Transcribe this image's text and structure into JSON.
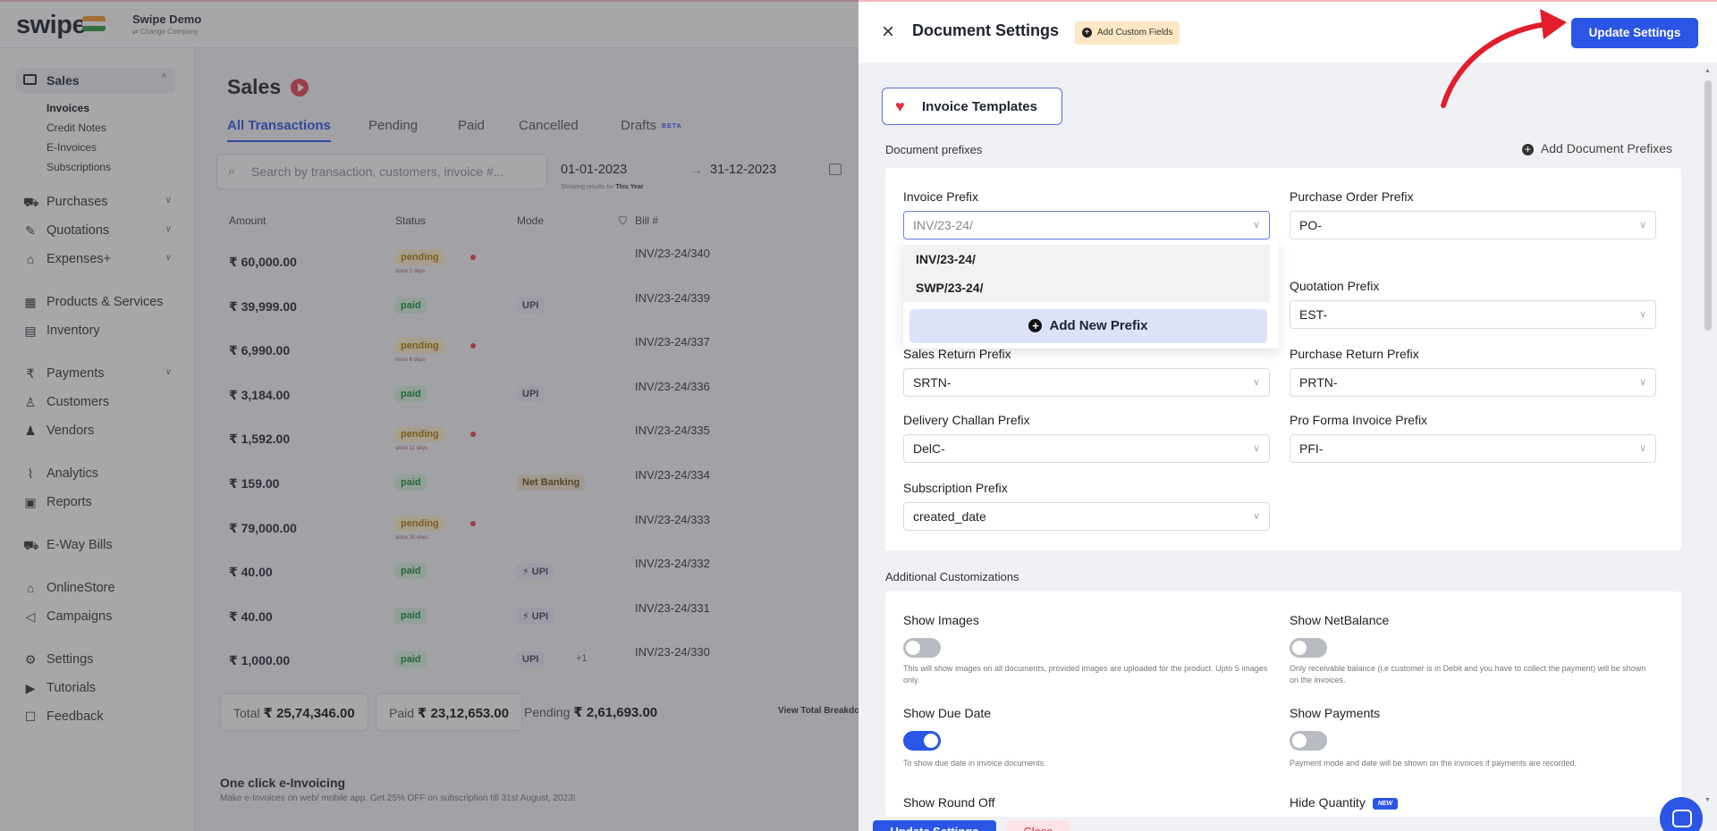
{
  "app": {
    "logo": "swipe",
    "company_name": "Swipe Demo",
    "company_sub": "⇄ Change Company"
  },
  "sidebar": {
    "sales_label": "Sales",
    "sales_sub": [
      "Invoices",
      "Credit Notes",
      "E-Invoices",
      "Subscriptions"
    ],
    "items": [
      {
        "label": "Purchases",
        "icon": "cart-icon"
      },
      {
        "label": "Quotations",
        "icon": "pen-icon"
      },
      {
        "label": "Expenses+",
        "icon": "tag-icon"
      },
      {
        "label": "Products & Services",
        "icon": "barcode-icon"
      },
      {
        "label": "Inventory",
        "icon": "warehouse-icon"
      },
      {
        "label": "Payments",
        "icon": "rupee-icon"
      },
      {
        "label": "Customers",
        "icon": "user-icon"
      },
      {
        "label": "Vendors",
        "icon": "users-icon"
      },
      {
        "label": "Analytics",
        "icon": "chart-icon"
      },
      {
        "label": "Reports",
        "icon": "report-icon"
      },
      {
        "label": "E-Way Bills",
        "icon": "truck-icon"
      },
      {
        "label": "OnlineStore",
        "icon": "store-icon"
      },
      {
        "label": "Campaigns",
        "icon": "megaphone-icon"
      },
      {
        "label": "Settings",
        "icon": "gear-icon"
      },
      {
        "label": "Tutorials",
        "icon": "youtube-icon"
      },
      {
        "label": "Feedback",
        "icon": "chat-icon"
      }
    ]
  },
  "main": {
    "title": "Sales",
    "tabs": [
      "All Transactions",
      "Pending",
      "Paid",
      "Cancelled",
      "Drafts"
    ],
    "beta": "BETA",
    "search_placeholder": "Search by transaction, customers, invoice #...",
    "date_from": "01-01-2023",
    "date_to": "31-12-2023",
    "date_arrow": "→",
    "showing_prefix": "Showing results for",
    "showing_value": "This Year",
    "columns": [
      "Amount",
      "Status",
      "Mode",
      "Bill #"
    ],
    "rows": [
      {
        "amount": "₹ 60,000.00",
        "status": "pending",
        "since": "since 2 days",
        "mode": "",
        "bill": "INV/23-24/340"
      },
      {
        "amount": "₹ 39,999.00",
        "status": "paid",
        "since": "",
        "mode": "UPI",
        "bill": "INV/23-24/339"
      },
      {
        "amount": "₹ 6,990.00",
        "status": "pending",
        "since": "since 6 days",
        "mode": "",
        "bill": "INV/23-24/337"
      },
      {
        "amount": "₹ 3,184.00",
        "status": "paid",
        "since": "",
        "mode": "UPI",
        "bill": "INV/23-24/336"
      },
      {
        "amount": "₹ 1,592.00",
        "status": "pending",
        "since": "since 11 days",
        "mode": "",
        "bill": "INV/23-24/335"
      },
      {
        "amount": "₹ 159.00",
        "status": "paid",
        "since": "",
        "mode": "Net Banking",
        "bill": "INV/23-24/334"
      },
      {
        "amount": "₹ 79,000.00",
        "status": "pending",
        "since": "since 20 days",
        "mode": "",
        "bill": "INV/23-24/333"
      },
      {
        "amount": "₹ 40.00",
        "status": "paid",
        "since": "",
        "mode": "⚡ UPI",
        "bill": "INV/23-24/332"
      },
      {
        "amount": "₹ 40.00",
        "status": "paid",
        "since": "",
        "mode": "⚡ UPI",
        "bill": "INV/23-24/331"
      },
      {
        "amount": "₹ 1,000.00",
        "status": "paid",
        "since": "",
        "mode": "UPI",
        "bill": "INV/23-24/330"
      }
    ],
    "plus_more": "+1",
    "total_label": "Total",
    "total_value": "₹ 25,74,346.00",
    "paid_label": "Paid",
    "paid_value": "₹ 23,12,653.00",
    "pending_label": "Pending",
    "pending_value": "₹ 2,61,693.00",
    "breakdown": "View Total Breakdown",
    "einvoice_title": "One click e-Invoicing",
    "einvoice_sub": "Make e-Invoices on web/ mobile app. Get 25% OFF on subscription till 31st August, 2023!"
  },
  "drawer": {
    "title": "Document Settings",
    "custom_fields": "Add Custom Fields",
    "update_label": "Update Settings",
    "close_label": "Close",
    "templates": "Invoice Templates",
    "prefix_section": "Document prefixes",
    "add_prefix": "Add Document Prefixes",
    "fields": {
      "invoice": {
        "label": "Invoice Prefix",
        "value": "INV/23-24/"
      },
      "purchase_order": {
        "label": "Purchase Order Prefix",
        "value": "PO-"
      },
      "quotation": {
        "label": "Quotation Prefix",
        "value": "EST-"
      },
      "sales_return": {
        "label": "Sales Return Prefix",
        "value": "SRTN-"
      },
      "purchase_return": {
        "label": "Purchase Return Prefix",
        "value": "PRTN-"
      },
      "delivery_challan": {
        "label": "Delivery Challan Prefix",
        "value": "DelC-"
      },
      "pro_forma": {
        "label": "Pro Forma Invoice Prefix",
        "value": "PFI-"
      },
      "subscription": {
        "label": "Subscription Prefix",
        "value": "created_date"
      }
    },
    "dropdown_options": [
      "INV/23-24/",
      "SWP/23-24/"
    ],
    "add_new_prefix": "Add New Prefix",
    "additional_section": "Additional Customizations",
    "toggles": {
      "show_images": {
        "label": "Show Images",
        "on": false,
        "desc": "This will show images on all documents, provided images are uploaded for the product. Upto 5 images only."
      },
      "show_net_balance": {
        "label": "Show NetBalance",
        "on": false,
        "desc": "Only receivable balance (i.e customer is in Debit and you have to collect the payment) will be shown on the invoices."
      },
      "show_due_date": {
        "label": "Show Due Date",
        "on": true,
        "desc": "To show due date in invoice documents."
      },
      "show_payments": {
        "label": "Show Payments",
        "on": false,
        "desc": "Payment mode and date will be shown on the invoices if payments are recorded."
      },
      "show_round_off": {
        "label": "Show Round Off"
      },
      "hide_quantity": {
        "label": "Hide Quantity",
        "badge": "NEW"
      }
    }
  },
  "colors": {
    "primary": "#2a55e5",
    "pending_bg": "#fff1cc",
    "paid_bg": "#d6f5dc",
    "arrow": "#e11d2b"
  }
}
